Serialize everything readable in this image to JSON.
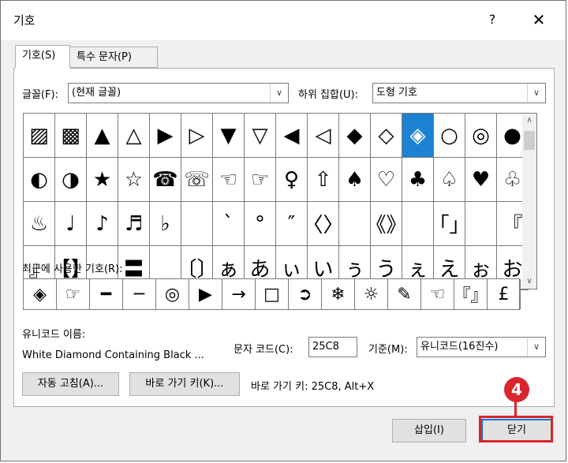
{
  "window": {
    "title": "기호",
    "help_glyph": "?",
    "close_glyph": "✕"
  },
  "tabs": [
    {
      "label": "기호(S)",
      "active": true
    },
    {
      "label": "특수 문자(P)",
      "active": false
    }
  ],
  "font_label": "글꼴(F):",
  "font_value": "(현재 글꼴)",
  "subset_label": "하위 집합(U):",
  "subset_value": "도형 기호",
  "dropdown_arrow": "∨",
  "symbol_rows": [
    [
      "▨",
      "▩",
      "▲",
      "△",
      "▶",
      "▷",
      "▼",
      "▽",
      "◀",
      "◁",
      "◆",
      "◇",
      "◈",
      "○",
      "◎",
      "●"
    ],
    [
      "◐",
      "◑",
      "★",
      "☆",
      "☎",
      "☏",
      "☜",
      "☞",
      "♀",
      "⇧",
      "♠",
      "♡",
      "♣",
      "♤",
      "♥",
      "♧"
    ],
    [
      "♨",
      "♩",
      "♪",
      "♬",
      "♭",
      "",
      "ˋ",
      "°",
      "″",
      "〈〉",
      "",
      "《》",
      "",
      "「」",
      "",
      "『"
    ],
    [
      "』",
      "【】",
      "",
      "〓",
      "",
      "〔〕",
      "ぁ",
      "あ",
      "ぃ",
      "い",
      "ぅ",
      "う",
      "ぇ",
      "え",
      "ぉ",
      "お"
    ]
  ],
  "selected_symbol": "◈",
  "scroll_up": "∧",
  "scroll_down": "∨",
  "recent_label": "최근에 사용한 기호(R):",
  "recent_symbols": [
    "◈",
    "☞",
    "━",
    "─",
    "◎",
    "▶",
    "→",
    "□",
    "➲",
    "❄",
    "☼",
    "✎",
    "☜",
    "『』",
    "£"
  ],
  "unicode_name_label": "유니코드 이름:",
  "unicode_name_value": "White Diamond Containing Black ...",
  "char_code_label": "문자 코드(C):",
  "char_code_value": "25C8",
  "base_label": "기준(M):",
  "base_value": "유니코드(16진수)",
  "autocorrect_button": "자동 고침(A)...",
  "shortcut_key_button": "바로 가기 키(K)...",
  "shortcut_key_text": "바로 가기 키: 25C8, Alt+X",
  "insert_button": "삽입(I)",
  "close_button": "닫기",
  "annotation": {
    "badge": "4",
    "color": "#d9262c"
  },
  "accent_color": "#1e82d2"
}
